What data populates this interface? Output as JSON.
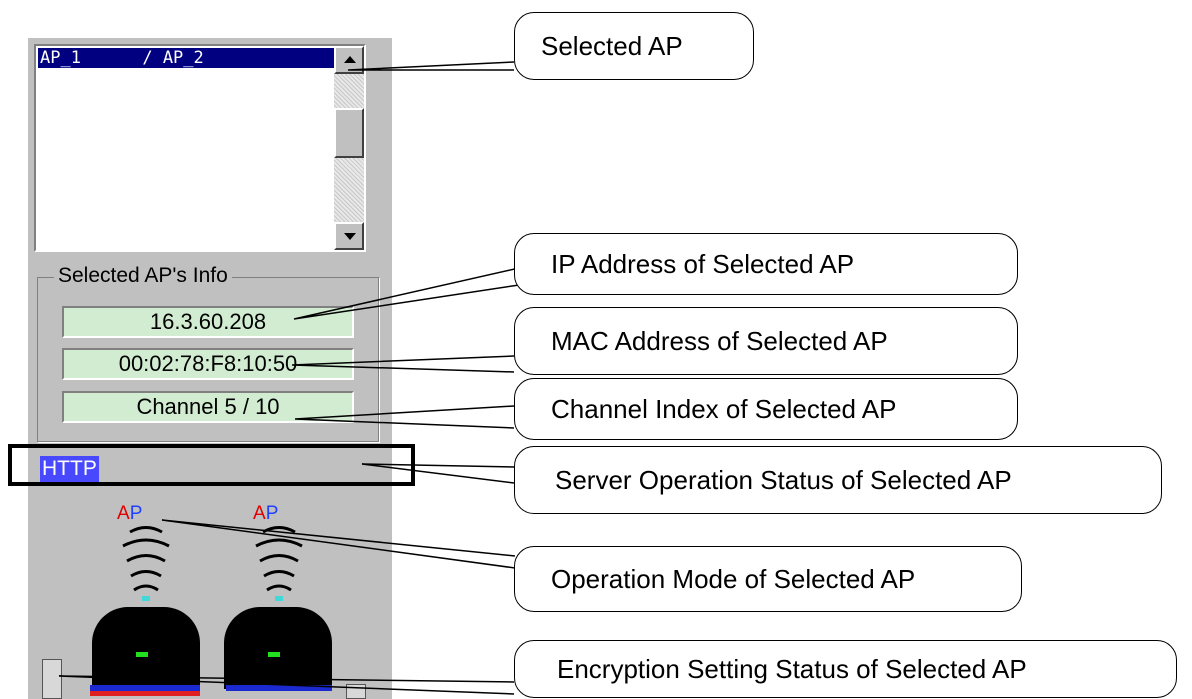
{
  "ap_list": {
    "selected_item": "AP_1      / AP_2"
  },
  "info_group": {
    "title": "Selected AP's Info",
    "ip_address": "16.3.60.208",
    "mac_address": "00:02:78:F8:10:50",
    "channel": "Channel 5 / 10"
  },
  "server_status": "HTTP",
  "operation_mode": {
    "left_label_a": "A",
    "left_label_p": "P",
    "right_label_a": "A",
    "right_label_p": "P"
  },
  "callouts": {
    "selected_ap": "Selected AP",
    "ip": "IP Address of Selected AP",
    "mac": "MAC Address of Selected AP",
    "channel": "Channel Index of Selected AP",
    "server": "Server Operation Status of Selected AP",
    "mode": "Operation Mode of Selected AP",
    "encryption": "Encryption Setting Status of Selected AP"
  },
  "colors": {
    "panel": "#c0c0c0",
    "selection": "#000080",
    "info_field": "#d2ecd2",
    "http_badge": "#4848ff",
    "signal_arcs": "#000000",
    "signal_dot": "#40d8d8",
    "label_a": "#e00000",
    "label_p": "#2040ff",
    "enc_bar_blue": "#1a2ad0",
    "enc_bar_red": "#e02020"
  },
  "icons": [
    "scroll-up-arrow-icon",
    "scroll-down-arrow-icon",
    "wifi-signal-icon",
    "access-point-device-icon",
    "padlock-open-icon",
    "padlock-icon"
  ]
}
